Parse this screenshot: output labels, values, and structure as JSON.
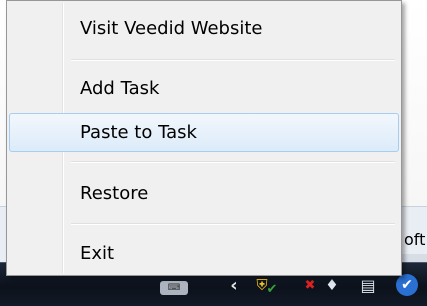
{
  "background_window": {
    "partial_text": "oft"
  },
  "context_menu": {
    "items": [
      {
        "label": "Visit Veedid Website"
      },
      {
        "label": "Add Task"
      },
      {
        "label": "Paste to Task"
      },
      {
        "label": "Restore"
      },
      {
        "label": "Exit"
      }
    ],
    "highlighted_item": "Paste to Task"
  },
  "taskbar": {
    "tray_icons": [
      {
        "name": "keyboard-language-icon",
        "glyph": "⌨"
      },
      {
        "name": "show-hidden-icons-chevron",
        "glyph": "‹"
      },
      {
        "name": "security-shield-icon",
        "glyph": "⛨"
      },
      {
        "name": "shield-check-icon",
        "glyph": "✔"
      },
      {
        "name": "error-x-icon",
        "glyph": "✖"
      },
      {
        "name": "volume-icon",
        "glyph": "♦"
      },
      {
        "name": "network-icon",
        "glyph": "▤"
      },
      {
        "name": "veedid-app-icon",
        "glyph": "✔"
      }
    ]
  }
}
